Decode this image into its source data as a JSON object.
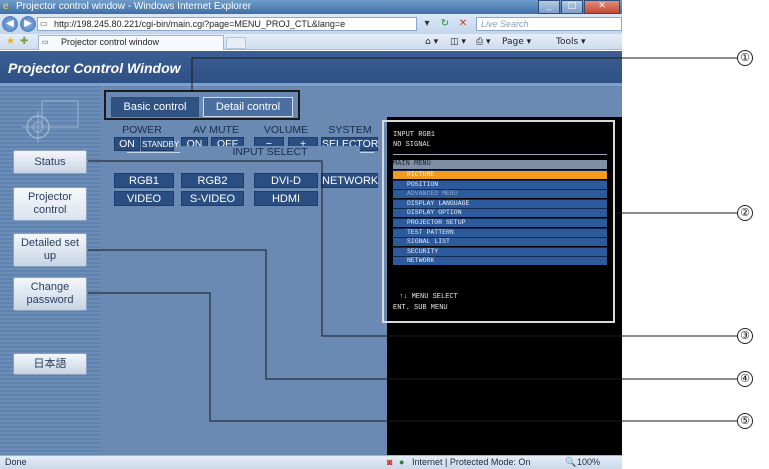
{
  "browser": {
    "window_title": "Projector control window - Windows Internet Explorer",
    "url": "http://198.245.80.221/cgi-bin/main.cgi?page=MENU_PROJ_CTL&lang=e",
    "search_placeholder": "Live Search",
    "tab_title": "Projector control window",
    "commands": {
      "page": "Page ▾",
      "tools": "Tools ▾"
    },
    "status_left": "Done",
    "status_zone": "Internet | Protected Mode: On",
    "zoom": "100%"
  },
  "app": {
    "title": "Projector Control Window",
    "sidebar": {
      "status": "Status",
      "projector_control": "Projector control",
      "detailed_setup": "Detailed set up",
      "change_password": "Change password",
      "language": "日本語"
    },
    "tabs": {
      "basic": "Basic control",
      "detail": "Detail control"
    },
    "groups": {
      "power": {
        "label": "POWER",
        "on": "ON",
        "standby": "STANDBY"
      },
      "av_mute": {
        "label": "AV MUTE",
        "on": "ON",
        "off": "OFF"
      },
      "volume": {
        "label": "VOLUME",
        "minus": "−",
        "plus": "+"
      },
      "system": {
        "label": "SYSTEM",
        "selector": "SELECTOR"
      },
      "input_select": {
        "label": "INPUT SELECT",
        "row1": [
          "RGB1",
          "RGB2",
          "DVI-D"
        ],
        "row2": [
          "VIDEO",
          "S-VIDEO",
          "HDMI"
        ]
      },
      "network": "NETWORK"
    },
    "osd": {
      "input": "INPUT RGB1",
      "signal": "NO SIGNAL",
      "menu_title": "MAIN MENU",
      "items": [
        "PICTURE",
        "POSITION",
        "ADVANCED MENU",
        "DISPLAY LANGUAGE",
        "DISPLAY OPTION",
        "PROJECTOR SETUP",
        "TEST PATTERN",
        "SIGNAL LIST",
        "SECURITY",
        "NETWORK"
      ],
      "selected_index": 0,
      "dim_index": 2,
      "help1": "↑↓  MENU SELECT",
      "help2": "ENT.  SUB MENU"
    }
  },
  "callouts": [
    "①",
    "②",
    "③",
    "④",
    "⑤"
  ]
}
